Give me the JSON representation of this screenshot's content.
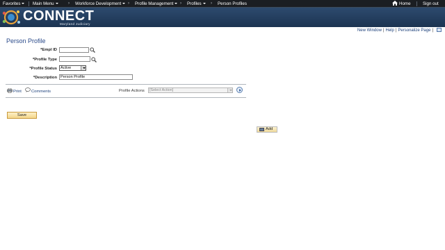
{
  "nav": {
    "favorites": "Favorites",
    "main_menu": "Main Menu",
    "crumb1": "Workforce Development",
    "crumb2": "Profile Management",
    "crumb3": "Profiles",
    "crumb4": "Person Profiles",
    "home": "Home",
    "signout": "Sign out"
  },
  "banner": {
    "logo": "CONNECT",
    "subtitle": "Maryland Judiciary"
  },
  "pagelinks": {
    "new_window": "New Window",
    "help": "Help",
    "personalize": "Personalize Page"
  },
  "page_title": "Person Profile",
  "form": {
    "empl_id_label": "*Empl ID",
    "empl_id_value": "",
    "profile_type_label": "*Profile Type",
    "profile_type_value": "",
    "profile_status_label": "*Profile Status",
    "profile_status_value": "Active",
    "description_label": "*Description",
    "description_value": "Person Profile"
  },
  "toolbar": {
    "print": "Print",
    "comments": "Comments",
    "profile_actions_label": "Profile Actions",
    "profile_actions_value": "[Select Action]"
  },
  "buttons": {
    "save": "Save",
    "add": "Add"
  },
  "colors": {
    "nav_bg": "#1b1e22",
    "banner_bg": "#2d4a6e",
    "link": "#1b3f7a",
    "title": "#2a4a8a",
    "button": "#f4d68a"
  }
}
